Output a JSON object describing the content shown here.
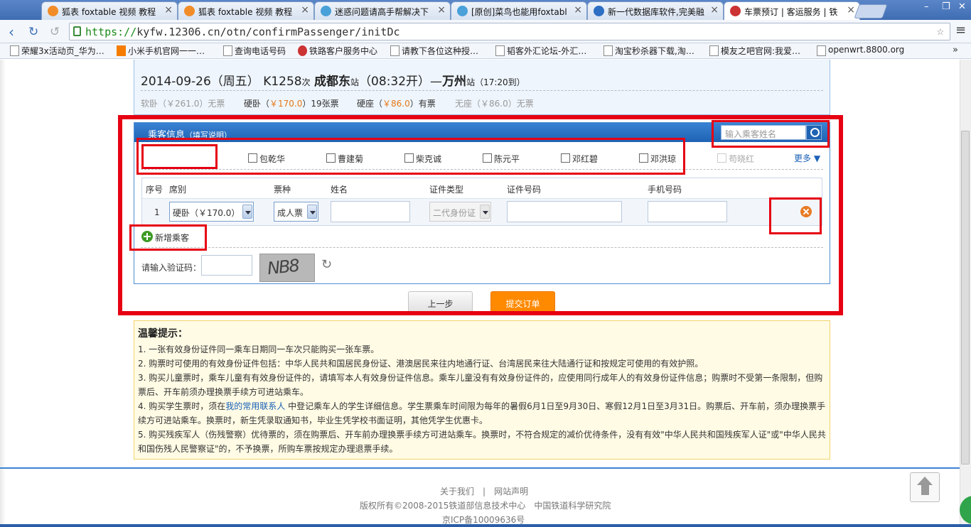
{
  "browser": {
    "tabs": [
      {
        "label": "狐表 foxtable 视频 教程"
      },
      {
        "label": "狐表 foxtable 视频 教程"
      },
      {
        "label": "迷惑问题请高手帮解决下"
      },
      {
        "label": "[原创]菜鸟也能用foxtabl"
      },
      {
        "label": "新一代数据库软件,完美融"
      },
      {
        "label": "车票预订 | 客运服务 | 铁"
      }
    ],
    "url_scheme": "https://",
    "url_rest": "kyfw.12306.cn/otn/confirmPassenger/initDc",
    "bookmarks": [
      "荣耀3x活动页_华为…",
      "小米手机官网一一…",
      "查询电话号码",
      "铁路客户服务中心",
      "请教下各位这种授…",
      "韬客外汇论坛-外汇…",
      "淘宝秒杀器下载,淘…",
      "模友之吧官网:我爱…",
      "openwrt.8800.org"
    ],
    "bookmarks_more": "»"
  },
  "train": {
    "date": "2014-09-26（周五）",
    "number": "K1258",
    "ci": "次",
    "from": "成都东",
    "zhan1": "站",
    "depart": "（08:32开）—",
    "to": "万州",
    "zhan2": "站",
    "arrive": "（17:20到）",
    "seats": [
      {
        "name": "软卧（",
        "price": "￥261.0",
        "close": "）",
        "status": "无票"
      },
      {
        "name": "硬卧（",
        "price": "￥170.0",
        "close": "）",
        "status": "19张票"
      },
      {
        "name": "硬座（",
        "price": "￥86.0",
        "close": "）",
        "status": "有票"
      },
      {
        "name": "无座（",
        "price": "￥86.0",
        "close": "）",
        "status": "无票"
      }
    ]
  },
  "passengers": {
    "title": "乘客信息",
    "help": "（填写说明）",
    "search_placeholder": "输入乘客姓名",
    "contacts": [
      "包乾华",
      "曹建菊",
      "柴克诚",
      "陈元平",
      "邓红碧",
      "邓洪琼",
      "苟晓红"
    ],
    "more": "更多",
    "headers": [
      "序号",
      "席别",
      "票种",
      "姓名",
      "证件类型",
      "证件号码",
      "手机号码"
    ],
    "rows": [
      {
        "index": "1",
        "seat": "硬卧（￥170.0）",
        "ticket_type": "成人票",
        "name": "",
        "id_type": "二代身份证",
        "id_no": "",
        "phone": ""
      }
    ],
    "add": "新增乘客",
    "captcha_label": "请输入验证码：",
    "captcha_text": "NB8"
  },
  "actions": {
    "prev": "上一步",
    "submit": "提交订单"
  },
  "tips": {
    "title": "温馨提示：",
    "items": [
      "1. 一张有效身份证件同一乘车日期同一车次只能购买一张车票。",
      "2. 购票时可使用的有效身份证件包括：中华人民共和国居民身份证、港澳居民来往内地通行证、台湾居民来往大陆通行证和按规定可使用的有效护照。",
      "3. 购买儿童票时，乘车儿童有有效身份证件的，请填写本人有效身份证件信息。乘车儿童没有有效身份证件的，应使用同行成年人的有效身份证件信息；购票时不受第一条限制，但购票后、开车前须办理换票手续方可进站乘车。",
      "5. 购买残疾军人（伤残警察）优待票的，须在购票后、开车前办理换票手续方可进站乘车。换票时，不符合规定的减价优待条件，没有有效\"中华人民共和国残疾军人证\"或\"中华人民共和国伤残人民警察证\"的，不予换票，所购车票按规定办理退票手续。"
    ],
    "item4_before": "4. 购买学生票时，须在",
    "item4_link": "我的常用联系人",
    "item4_after": " 中登记乘车人的学生详细信息。学生票乘车时间限为每年的暑假6月1日至9月30日、寒假12月1日至3月31日。购票后、开车前，须办理换票手续方可进站乘车。换票时，新生凭录取通知书，毕业生凭学校书面证明，其他凭学生优惠卡。"
  },
  "footer": {
    "about": "关于我们",
    "sep": "|",
    "statement": "网站声明",
    "copyright": "版权所有©2008-2015铁道部信息技术中心　中国铁道科学研究院",
    "icp": "京ICP备10009636号"
  },
  "colors": {
    "highlight_red": "#e60012",
    "accent_blue": "#1f63b3",
    "price_orange": "#e67817",
    "submit_orange": "#ff8a00"
  }
}
